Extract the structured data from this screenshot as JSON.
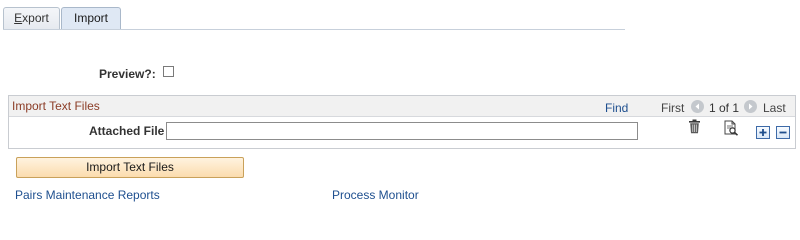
{
  "tabs": [
    {
      "label_accel": "E",
      "label_rest": "xport",
      "active": false
    },
    {
      "label": "Import",
      "active": true
    }
  ],
  "preview": {
    "label": "Preview?:",
    "checked": false
  },
  "scroll_area": {
    "title": "Import Text Files",
    "find_label": "Find",
    "first_label": "First",
    "count_text": "1 of 1",
    "last_label": "Last",
    "attached_file_label": "Attached File",
    "attached_file_value": ""
  },
  "icons": {
    "prev": "chevron-left-icon",
    "next": "chevron-right-icon",
    "delete": "trash-icon",
    "view": "view-attachment-icon",
    "add": "plus-icon",
    "remove": "minus-icon"
  },
  "import_button_label": "Import Text Files",
  "links": {
    "pairs": "Pairs Maintenance Reports",
    "process_monitor": "Process Monitor"
  },
  "colors": {
    "section_title": "#8b3c26",
    "link": "#1e4f8f",
    "button_bg": "#fbdcae",
    "active_tab_bg": "#dfe8f4"
  }
}
